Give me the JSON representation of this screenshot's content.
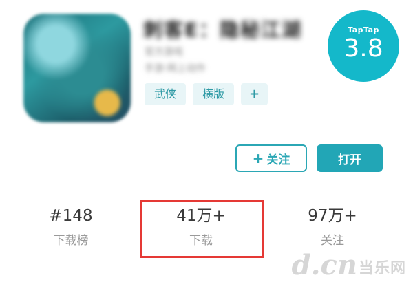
{
  "app": {
    "title": "刺客E：隐秘江湖",
    "subtitle_line1": "官方游戏",
    "subtitle_line2": "手游·网上动作",
    "tags": [
      "武侠",
      "横版",
      "+"
    ]
  },
  "rating": {
    "brand": "TapTap",
    "score": "3.8"
  },
  "actions": {
    "follow_label": "关注",
    "follow_plus": "+",
    "open_label": "打开"
  },
  "stats": {
    "rank_value": "#148",
    "rank_label": "下载榜",
    "downloads_value": "41万+",
    "downloads_label": "下载",
    "follows_value": "97万+",
    "follows_label": "关注"
  },
  "watermark": {
    "logo": "d.cn",
    "text": "当乐网"
  },
  "colors": {
    "accent": "#22a6b6",
    "rating_bg": "#14b8ca",
    "tag_bg": "#e8f5f7",
    "tag_text": "#2e9aa5",
    "highlight": "#e53935"
  }
}
